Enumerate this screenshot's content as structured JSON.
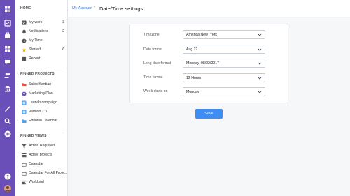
{
  "colors": {
    "rail": "#6b4fb8",
    "accent": "#3f8cf3",
    "link": "#3a7bd5",
    "starred": "#f5b400",
    "folder": "#e8534b",
    "blue_item": "#4ea4f4"
  },
  "sidebar": {
    "home_title": "HOME",
    "home_items": [
      {
        "label": "My work",
        "count": "3",
        "icon": "checkbox-icon"
      },
      {
        "label": "Notifications",
        "count": "2",
        "icon": "bell-icon"
      },
      {
        "label": "My Time",
        "count": "",
        "icon": "clock-icon"
      },
      {
        "label": "Starred",
        "count": "6",
        "icon": "star-icon"
      },
      {
        "label": "Recent",
        "count": "",
        "icon": "recent-icon"
      }
    ],
    "pinned_projects_title": "PINNED PROJECTS",
    "pinned_projects": [
      {
        "label": "Sales Kanban",
        "icon": "folder-icon"
      },
      {
        "label": "Marketing Plan",
        "icon": "project-icon"
      },
      {
        "label": "Launch campaign",
        "icon": "project-icon"
      },
      {
        "label": "Version 2.0",
        "icon": "project-icon"
      },
      {
        "label": "Editorial Calendar",
        "icon": "folder-icon"
      }
    ],
    "pinned_views_title": "PINNED VIEWS",
    "pinned_views": [
      {
        "label": "Action Required",
        "icon": "filter-icon"
      },
      {
        "label": "Active projects",
        "icon": "list-icon"
      },
      {
        "label": "Calendar",
        "icon": "calendar-icon"
      },
      {
        "label": "Calendar For All Proje...",
        "icon": "calendar-icon"
      },
      {
        "label": "Workload",
        "icon": "workload-icon"
      }
    ]
  },
  "breadcrumb": {
    "link": "My Account",
    "separator": "/",
    "title": "Date/Time settings"
  },
  "form": {
    "fields": [
      {
        "label": "Timezone",
        "value": "America/New_York"
      },
      {
        "label": "Date format",
        "value": "Aug 22"
      },
      {
        "label": "Long date format",
        "value": "Monday, 08/22/2017"
      },
      {
        "label": "Time format",
        "value": "12 Hours"
      },
      {
        "label": "Week starts on",
        "value": "Monday"
      }
    ],
    "save_label": "Save"
  }
}
